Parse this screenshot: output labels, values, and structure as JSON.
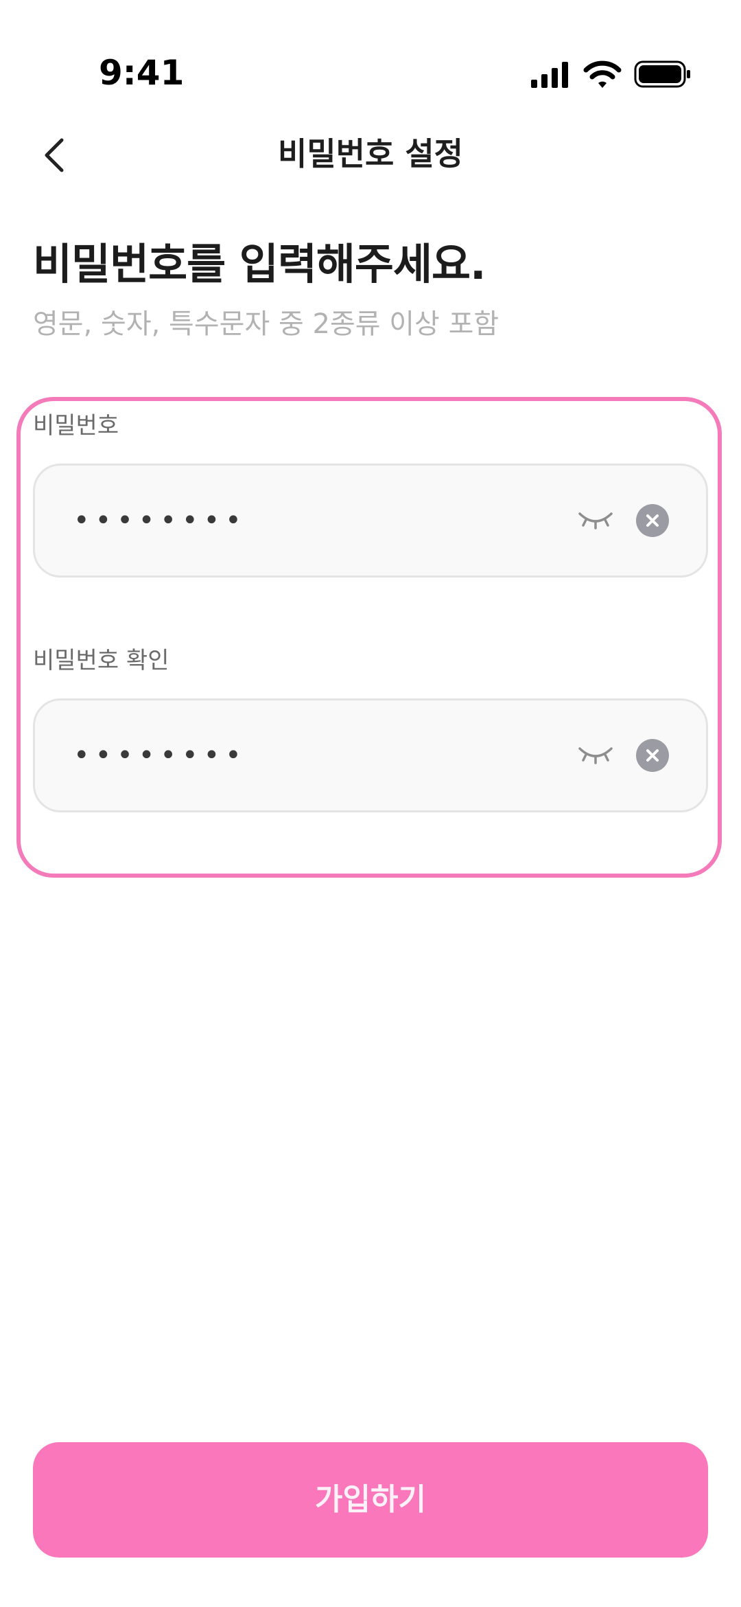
{
  "status_bar": {
    "time": "9:41",
    "icons": [
      "signal-icon",
      "wifi-icon",
      "battery-icon"
    ]
  },
  "header": {
    "title": "비밀번호 설정",
    "back_icon": "chevron-left-icon"
  },
  "main": {
    "heading": "비밀번호를 입력해주세요.",
    "subtitle": "영문, 숫자, 특수문자 중 2종류 이상 포함"
  },
  "form": {
    "password": {
      "label": "비밀번호",
      "value": "••••••••",
      "visibility_icon": "eye-closed-icon",
      "clear_icon": "clear-circle-icon"
    },
    "password_confirm": {
      "label": "비밀번호 확인",
      "value": "••••••••",
      "visibility_icon": "eye-closed-icon",
      "clear_icon": "clear-circle-icon"
    }
  },
  "footer": {
    "submit_label": "가입하기"
  },
  "colors": {
    "accent": "#fb77bc",
    "highlight_border": "#f47ab9",
    "subtitle_text": "#b2b2b2",
    "input_background": "#f9f9f9",
    "clear_button": "#9b9ba3"
  }
}
